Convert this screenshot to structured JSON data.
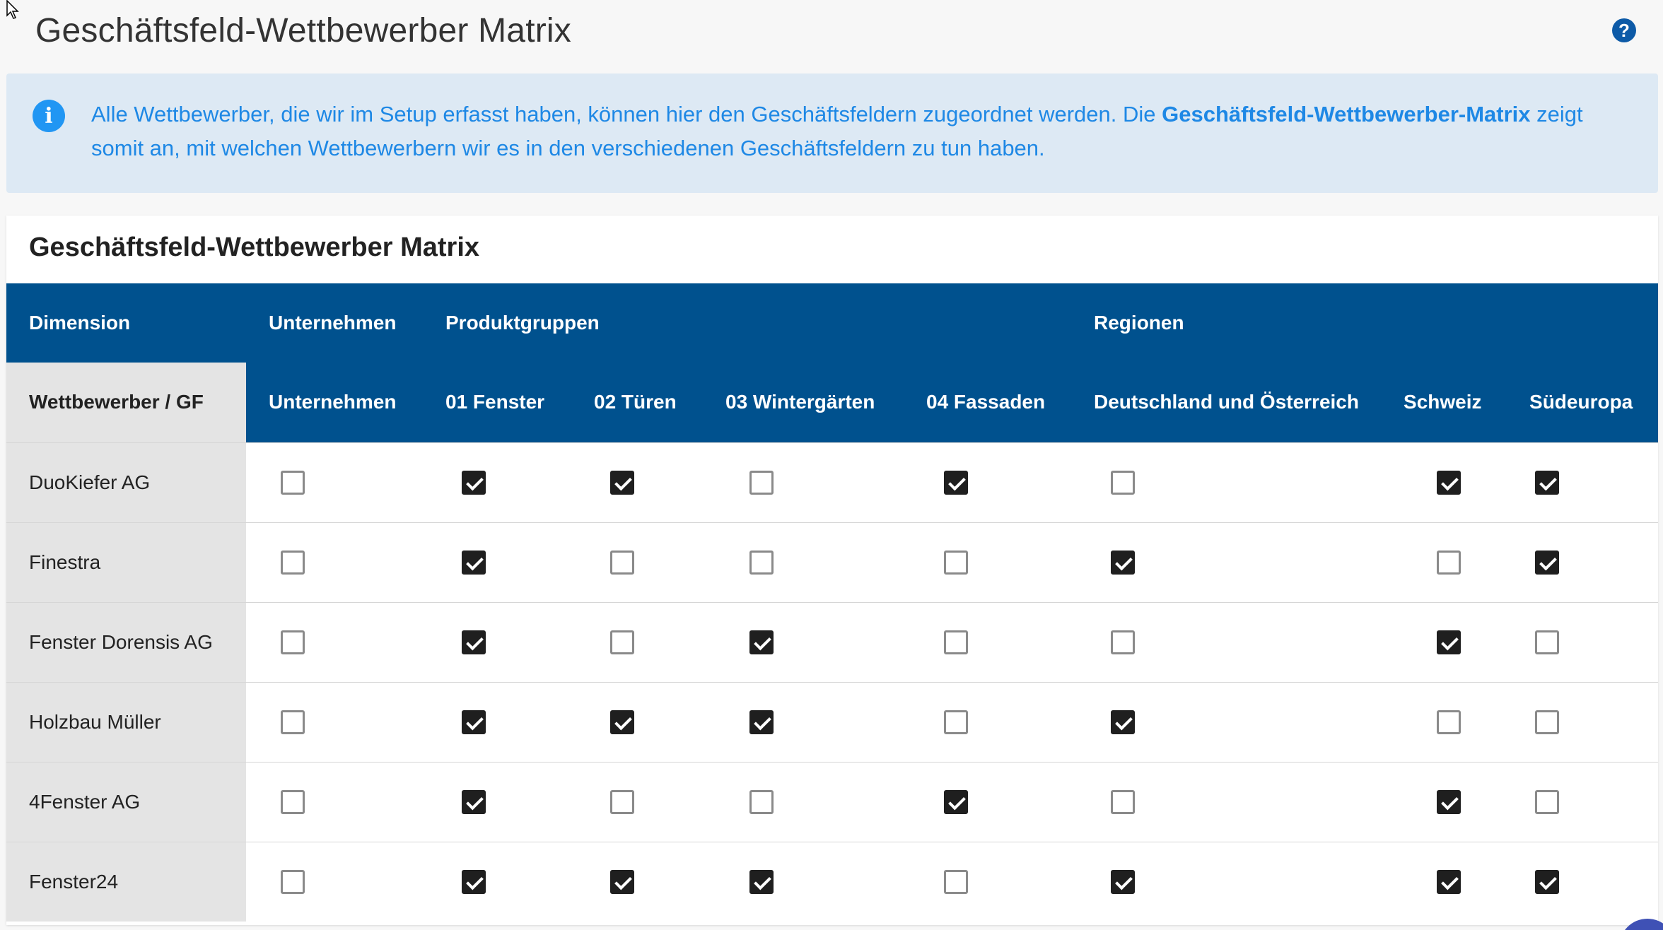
{
  "page": {
    "title": "Geschäftsfeld-Wettbewerber Matrix",
    "help_glyph": "?"
  },
  "info": {
    "text_before": "Alle Wettbewerber, die wir im Setup erfasst haben, können hier den Geschäftsfeldern zugeordnet werden. Die ",
    "text_bold": "Geschäftsfeld-Wettbewerber-Matrix",
    "text_after": " zeigt somit an, mit welchen Wettbewerbern wir es in den verschiedenen Geschäftsfeldern zu tun haben.",
    "icon_glyph": "i"
  },
  "card": {
    "title": "Geschäftsfeld-Wettbewerber Matrix"
  },
  "table": {
    "dimension_label": "Dimension",
    "dimension_groups": [
      "Unternehmen",
      "Produktgruppen",
      "Regionen"
    ],
    "corner_label": "Wettbewerber / GF",
    "columns": [
      "Unternehmen",
      "01 Fenster",
      "02 Türen",
      "03 Wintergärten",
      "04 Fassaden",
      "Deutschland und Österreich",
      "Schweiz",
      "Südeuropa"
    ],
    "rows": [
      {
        "name": "DuoKiefer AG",
        "values": [
          false,
          true,
          true,
          false,
          true,
          false,
          true,
          true
        ]
      },
      {
        "name": "Finestra",
        "values": [
          false,
          true,
          false,
          false,
          false,
          true,
          false,
          true
        ]
      },
      {
        "name": "Fenster Dorensis AG",
        "values": [
          false,
          true,
          false,
          true,
          false,
          false,
          true,
          false
        ]
      },
      {
        "name": "Holzbau Müller",
        "values": [
          false,
          true,
          true,
          true,
          false,
          true,
          false,
          false
        ]
      },
      {
        "name": "4Fenster AG",
        "values": [
          false,
          true,
          false,
          false,
          true,
          false,
          true,
          false
        ]
      },
      {
        "name": "Fenster24",
        "values": [
          false,
          true,
          true,
          true,
          false,
          true,
          true,
          true
        ]
      }
    ]
  },
  "colors": {
    "header_blue": "#00518e",
    "info_background": "#dde9f4",
    "info_text": "#1e88e5",
    "checkbox_checked": "#1f1f1f"
  }
}
